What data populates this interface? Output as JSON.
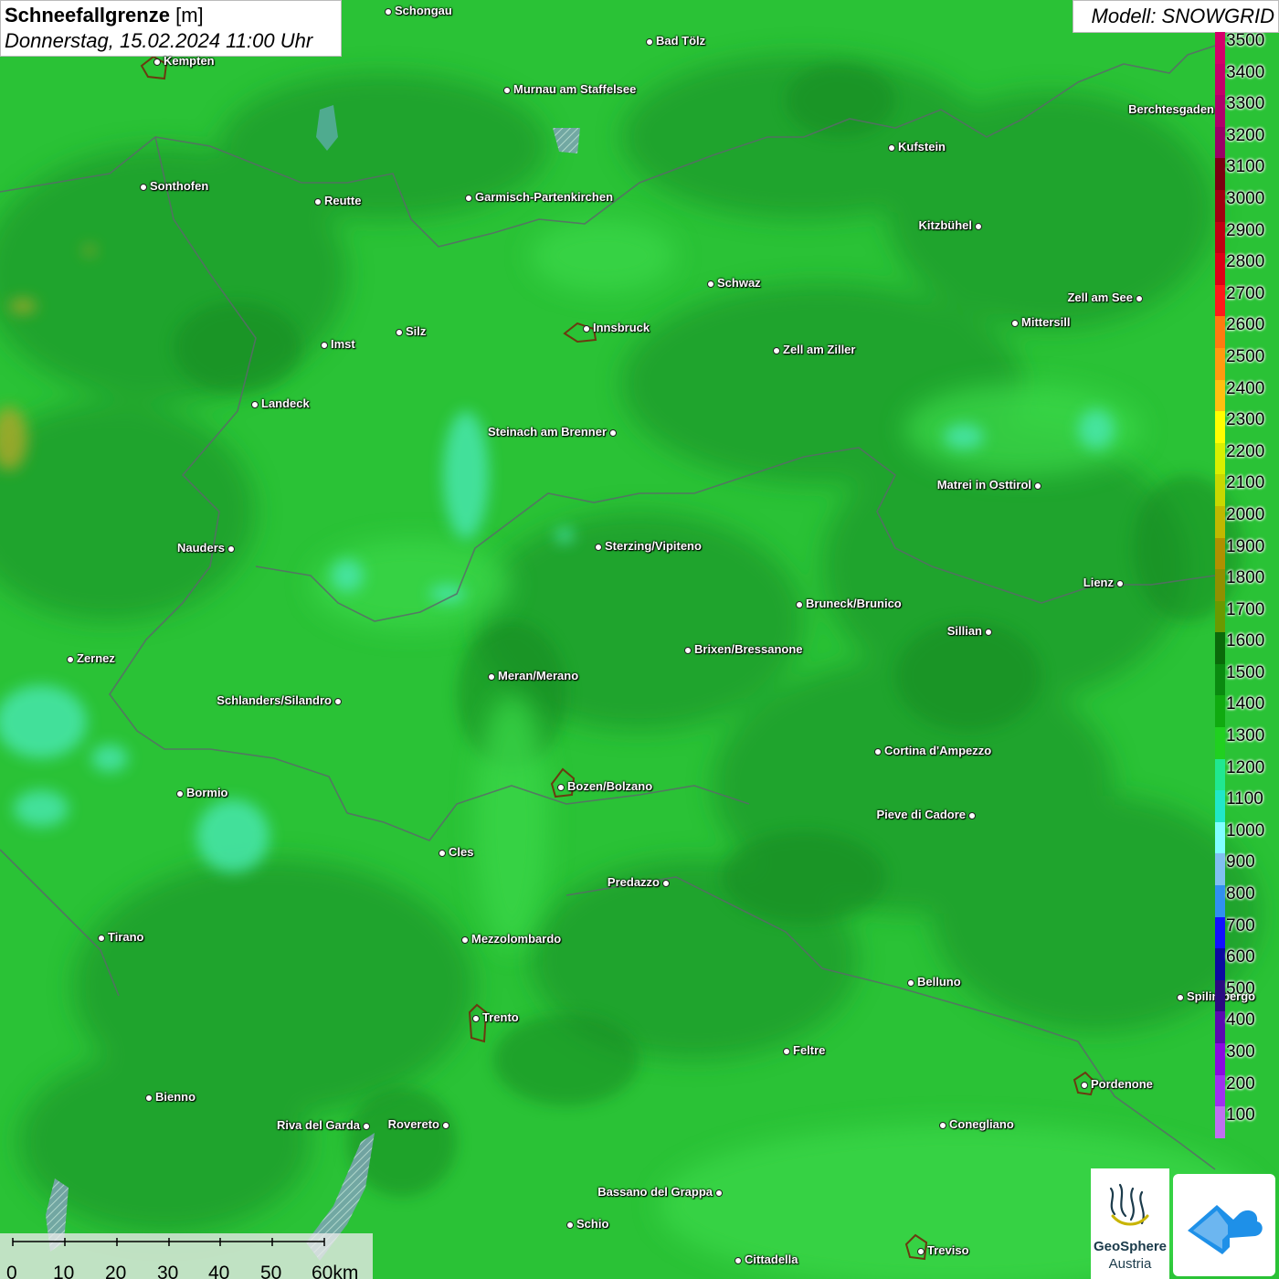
{
  "title": {
    "parameter": "Schneefallgrenze",
    "unit": "[m]",
    "datetime": "Donnerstag, 15.02.2024 11:00 Uhr"
  },
  "model_label": "Modell: SNOWGRID",
  "legend": {
    "levels": [
      {
        "label": "3500",
        "color": "#d4006a"
      },
      {
        "label": "3400",
        "color": "#c4006a"
      },
      {
        "label": "3300",
        "color": "#b0006a"
      },
      {
        "label": "3200",
        "color": "#9a0066"
      },
      {
        "label": "3100",
        "color": "#7a0010"
      },
      {
        "label": "3000",
        "color": "#a00010"
      },
      {
        "label": "2900",
        "color": "#c00012"
      },
      {
        "label": "2800",
        "color": "#dd0016"
      },
      {
        "label": "2700",
        "color": "#ff1a1a"
      },
      {
        "label": "2600",
        "color": "#ff7a10"
      },
      {
        "label": "2500",
        "color": "#ff9a10"
      },
      {
        "label": "2400",
        "color": "#ffc010"
      },
      {
        "label": "2300",
        "color": "#ffff00"
      },
      {
        "label": "2200",
        "color": "#d8f000"
      },
      {
        "label": "2100",
        "color": "#c8d800"
      },
      {
        "label": "2000",
        "color": "#c0b800"
      },
      {
        "label": "1900",
        "color": "#b09000"
      },
      {
        "label": "1800",
        "color": "#909000"
      },
      {
        "label": "1700",
        "color": "#6a9a00"
      },
      {
        "label": "1600",
        "color": "#0a6a0a"
      },
      {
        "label": "1500",
        "color": "#0a8a10"
      },
      {
        "label": "1400",
        "color": "#10aa10"
      },
      {
        "label": "1300",
        "color": "#20d020"
      },
      {
        "label": "1200",
        "color": "#20e890"
      },
      {
        "label": "1100",
        "color": "#20e8c8"
      },
      {
        "label": "1000",
        "color": "#80ffff"
      },
      {
        "label": "900",
        "color": "#80c0f0"
      },
      {
        "label": "800",
        "color": "#3090f0"
      },
      {
        "label": "700",
        "color": "#1010ff"
      },
      {
        "label": "600",
        "color": "#0a0aa0"
      },
      {
        "label": "500",
        "color": "#2a0a80"
      },
      {
        "label": "400",
        "color": "#5a0ab0"
      },
      {
        "label": "300",
        "color": "#8a0ae0"
      },
      {
        "label": "200",
        "color": "#a030f0"
      },
      {
        "label": "100",
        "color": "#c070f0"
      }
    ]
  },
  "scale_bar": {
    "ticks": [
      "0",
      "10",
      "20",
      "30",
      "40",
      "50",
      "60km"
    ]
  },
  "logos": {
    "geosphere_line1": "GeoSphere",
    "geosphere_line2": "Austria"
  },
  "cities": [
    {
      "name": "Schongau",
      "side": "r"
    },
    {
      "name": "Bad Tölz",
      "side": "r"
    },
    {
      "name": "Kempten",
      "side": "r"
    },
    {
      "name": "Murnau am Staffelsee",
      "side": "r"
    },
    {
      "name": "Berchtesgaden",
      "side": "l"
    },
    {
      "name": "Kufstein",
      "side": "r"
    },
    {
      "name": "Sonthofen",
      "side": "r"
    },
    {
      "name": "Reutte",
      "side": "r"
    },
    {
      "name": "Garmisch-Partenkirchen",
      "side": "r"
    },
    {
      "name": "Kitzbühel",
      "side": "l"
    },
    {
      "name": "Schwaz",
      "side": "r"
    },
    {
      "name": "Zell am See",
      "side": "l"
    },
    {
      "name": "Mittersill",
      "side": "r"
    },
    {
      "name": "Innsbruck",
      "side": "r"
    },
    {
      "name": "Silz",
      "side": "r"
    },
    {
      "name": "Imst",
      "side": "r"
    },
    {
      "name": "Zell am Ziller",
      "side": "r"
    },
    {
      "name": "Landeck",
      "side": "r"
    },
    {
      "name": "Steinach am Brenner",
      "side": "l"
    },
    {
      "name": "Matrei in Osttirol",
      "side": "l"
    },
    {
      "name": "Nauders",
      "side": "l"
    },
    {
      "name": "Sterzing/Vipiteno",
      "side": "r"
    },
    {
      "name": "Lienz",
      "side": "l"
    },
    {
      "name": "Bruneck/Brunico",
      "side": "r"
    },
    {
      "name": "Sillian",
      "side": "l"
    },
    {
      "name": "Brixen/Bressanone",
      "side": "r"
    },
    {
      "name": "Zernez",
      "side": "r"
    },
    {
      "name": "Meran/Merano",
      "side": "r"
    },
    {
      "name": "Schlanders/Silandro",
      "side": "l"
    },
    {
      "name": "Cortina d'Ampezzo",
      "side": "r"
    },
    {
      "name": "Bozen/Bolzano",
      "side": "r"
    },
    {
      "name": "Bormio",
      "side": "r"
    },
    {
      "name": "Pieve di Cadore",
      "side": "l"
    },
    {
      "name": "Cles",
      "side": "r"
    },
    {
      "name": "Predazzo",
      "side": "l"
    },
    {
      "name": "Tirano",
      "side": "r"
    },
    {
      "name": "Mezzolombardo",
      "side": "r"
    },
    {
      "name": "Belluno",
      "side": "r"
    },
    {
      "name": "Spilimbergo",
      "side": "r"
    },
    {
      "name": "Trento",
      "side": "r"
    },
    {
      "name": "Feltre",
      "side": "r"
    },
    {
      "name": "Pordenone",
      "side": "r"
    },
    {
      "name": "Bienno",
      "side": "r"
    },
    {
      "name": "Riva del Garda",
      "side": "l"
    },
    {
      "name": "Rovereto",
      "side": "l"
    },
    {
      "name": "Conegliano",
      "side": "r"
    },
    {
      "name": "Bassano del Grappa",
      "side": "l"
    },
    {
      "name": "Schio",
      "side": "r"
    },
    {
      "name": "Treviso",
      "side": "r"
    },
    {
      "name": "Cittadella",
      "side": "r"
    }
  ]
}
